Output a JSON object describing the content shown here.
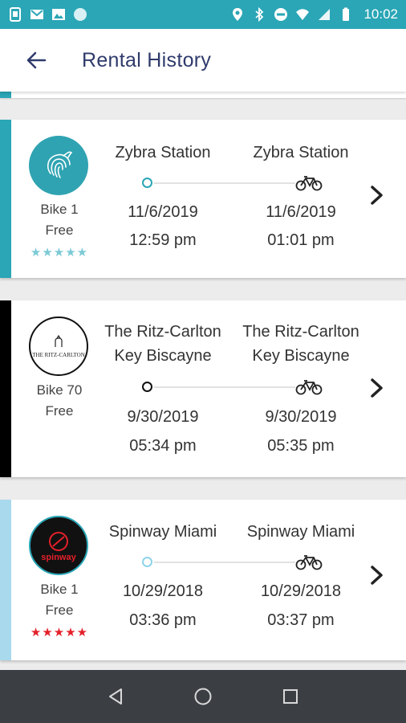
{
  "status_bar": {
    "time": "10:02",
    "left_icons": [
      "phone-sim-icon",
      "gmail-icon",
      "image-icon",
      "circle-icon"
    ],
    "right_icons": [
      "location-icon",
      "bluetooth-icon",
      "do-not-disturb-icon",
      "wifi-icon",
      "signal-icon",
      "battery-icon"
    ]
  },
  "header": {
    "title": "Rental History",
    "back_icon": "arrow-back-icon"
  },
  "colors": {
    "primary": "#2aa6b6",
    "title": "#2f3a6b",
    "zybra_accent": "#2aa6b6",
    "ritz_accent": "#000000",
    "spinway_accent": "#a9d9ec",
    "spinway_stars": "#e4202a",
    "zybra_stars": "#7ccad6"
  },
  "rentals": [
    {
      "logo": "zybra-logo",
      "bike": "Bike 1",
      "price": "Free",
      "rating_stars": 5,
      "stars_text": "★★★★★",
      "start_station": "Zybra Station",
      "end_station": "Zybra Station",
      "start_date": "11/6/2019",
      "end_date": "11/6/2019",
      "start_time": "12:59 pm",
      "end_time": "01:01 pm"
    },
    {
      "logo": "ritz-carlton-logo",
      "logo_text": "THE RITZ-CARLTON",
      "bike": "Bike 70",
      "price": "Free",
      "start_station": "The Ritz-Carlton Key Biscayne",
      "start_station_line1": "The Ritz-Carlton",
      "start_station_line2": "Key Biscayne",
      "end_station": "The Ritz-Carlton Key Biscayne",
      "end_station_line1": "The Ritz-Carlton",
      "end_station_line2": "Key Biscayne",
      "start_date": "9/30/2019",
      "end_date": "9/30/2019",
      "start_time": "05:34 pm",
      "end_time": "05:35 pm"
    },
    {
      "logo": "spinway-logo",
      "logo_text": "spinway",
      "bike": "Bike 1",
      "price": "Free",
      "rating_stars": 5,
      "stars_text": "★★★★★",
      "start_station": "Spinway Miami",
      "end_station": "Spinway Miami",
      "start_date": "10/29/2018",
      "end_date": "10/29/2018",
      "start_time": "03:36 pm",
      "end_time": "03:37 pm"
    }
  ],
  "nav_bar": {
    "icons": [
      "back-triangle-icon",
      "home-circle-icon",
      "recents-square-icon"
    ]
  }
}
